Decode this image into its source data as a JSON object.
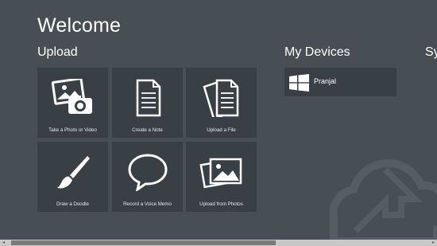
{
  "page": {
    "title": "Welcome"
  },
  "upload": {
    "heading": "Upload",
    "tiles": [
      {
        "label": "Take a Photo or Video",
        "icon": "camera-photo-icon"
      },
      {
        "label": "Create a Note",
        "icon": "note-icon"
      },
      {
        "label": "Upload a File",
        "icon": "files-icon"
      },
      {
        "label": "Draw a Doodle",
        "icon": "paintbrush-icon"
      },
      {
        "label": "Record a Voice Memo",
        "icon": "speech-bubble-icon"
      },
      {
        "label": "Upload from Photos",
        "icon": "photos-icon"
      }
    ]
  },
  "devices": {
    "heading": "My Devices",
    "items": [
      {
        "name": "Pranjal",
        "icon": "windows-logo-icon"
      }
    ]
  },
  "next_section": {
    "heading_fragment": "Sy"
  },
  "scrollbar": {
    "left_arrow": "◂",
    "right_arrow": "▸"
  },
  "colors": {
    "background": "#484f54",
    "tile": "#394045",
    "text": "#ffffff"
  }
}
